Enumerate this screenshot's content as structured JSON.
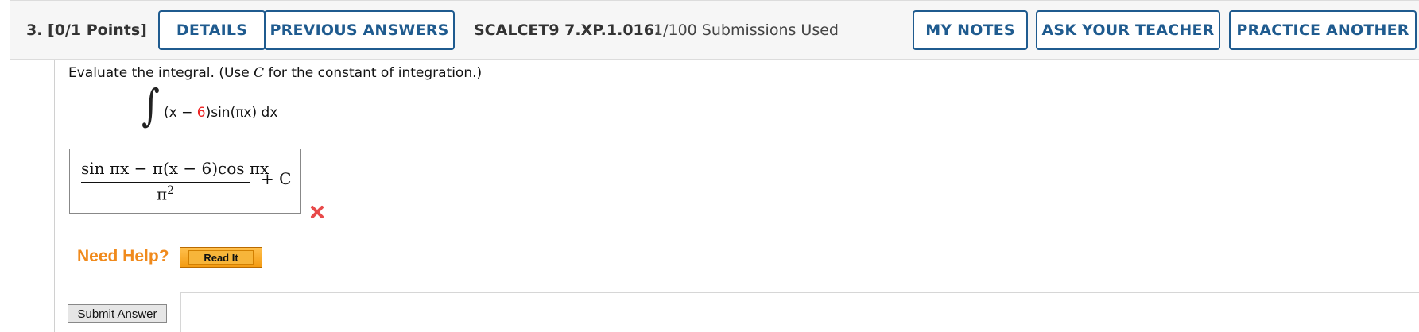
{
  "header": {
    "question_label": "3.  [0/1 Points]",
    "details_label": "DETAILS",
    "previous_answers_label": "PREVIOUS ANSWERS",
    "problem_code": "SCALCET9 7.XP.1.016.",
    "submissions_used": "1/100 Submissions Used",
    "my_notes_label": "MY NOTES",
    "ask_teacher_label": "ASK YOUR TEACHER",
    "practice_another_label": "PRACTICE ANOTHER"
  },
  "question": {
    "prompt_before": "Evaluate the integral. (Use ",
    "prompt_var": "C",
    "prompt_after": " for the constant of integration.)",
    "integral_sign": "∫",
    "integrand_open": "(x − ",
    "integrand_number": "6",
    "integrand_rest": ")sin(πx) dx"
  },
  "answer": {
    "numerator": "sin πx − π(x − 6)cos πx",
    "denominator_base": "π",
    "denominator_exp": "2",
    "plus_constant": "+ C",
    "status_icon": "incorrect-x-icon",
    "status_color": "#e84a4a"
  },
  "help": {
    "need_help_label": "Need Help?",
    "read_it_label": "Read It"
  },
  "submit_label": "Submit Answer",
  "colors": {
    "accent": "#1f5b8f",
    "highlight_number": "#e22222",
    "need_help": "#f08a1c"
  }
}
